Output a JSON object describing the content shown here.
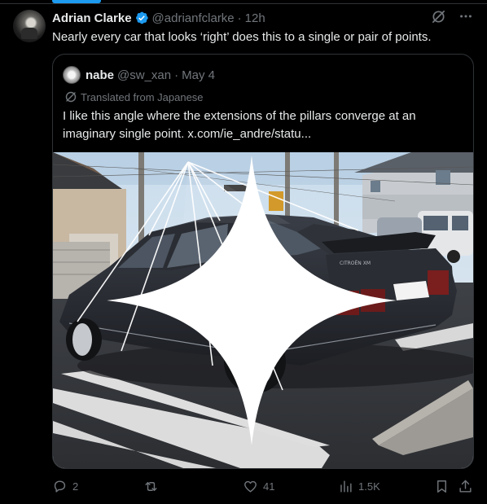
{
  "author": {
    "name": "Adrian Clarke",
    "handle": "@adrianfclarke",
    "separator": "·",
    "time": "12h",
    "verified_color": "#1d9bf0"
  },
  "tweet": {
    "text": "Nearly every car that looks ‘right’ does this to a single or pair of points."
  },
  "quoted": {
    "name": "nabe",
    "handle": "@sw_xan",
    "separator": "·",
    "date": "May 4",
    "translated_label": "Translated from Japanese",
    "text": "I like this angle where the extensions of the pillars converge at an imaginary single point. x.com/ie_andre/statu...",
    "photo_text": "CITROËN XM"
  },
  "actions": {
    "replies": "2",
    "reposts": "",
    "likes": "41",
    "views": "1.5K"
  },
  "icons": {
    "grok": "grok-icon",
    "more": "more-icon",
    "reply": "reply-icon",
    "repost": "repost-icon",
    "like": "heart-icon",
    "views": "views-icon",
    "bookmark": "bookmark-icon",
    "share": "share-icon"
  },
  "colors": {
    "background": "#000000",
    "text": "#e7e9ea",
    "muted": "#71767b",
    "border": "#2f3336",
    "accent": "#1d9bf0"
  }
}
